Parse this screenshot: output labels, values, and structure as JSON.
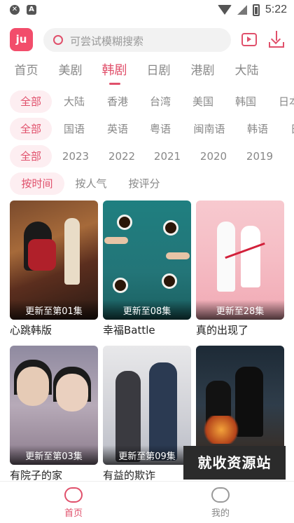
{
  "status": {
    "time": "5:22"
  },
  "app": {
    "logo_text": "ju"
  },
  "search": {
    "placeholder": "可尝试模糊搜索"
  },
  "tabs": [
    {
      "label": "首页"
    },
    {
      "label": "美剧"
    },
    {
      "label": "韩剧"
    },
    {
      "label": "日剧"
    },
    {
      "label": "港剧"
    },
    {
      "label": "大陆"
    }
  ],
  "active_tab": "韩剧",
  "filters": {
    "region": [
      "全部",
      "大陆",
      "香港",
      "台湾",
      "美国",
      "韩国",
      "日本"
    ],
    "language": [
      "全部",
      "国语",
      "英语",
      "粤语",
      "闽南语",
      "韩语",
      "日语"
    ],
    "year": [
      "全部",
      "2023",
      "2022",
      "2021",
      "2020",
      "2019"
    ],
    "sort": [
      "按时间",
      "按人气",
      "按评分"
    ]
  },
  "cards": [
    {
      "title": "心跳韩版",
      "episode": "更新至第01集"
    },
    {
      "title": "幸福Battle",
      "episode": "更新至08集"
    },
    {
      "title": "真的出现了",
      "episode": "更新至28集"
    },
    {
      "title": "有院子的家",
      "episode": "更新至第03集"
    },
    {
      "title": "有益的欺诈",
      "episode": "更新至第09集"
    },
    {
      "title": "",
      "episode": ""
    }
  ],
  "watermark": "就收资源站",
  "bottom_nav": [
    {
      "label": "首页"
    },
    {
      "label": "我的"
    }
  ],
  "colors": {
    "accent": "#e0506b"
  }
}
